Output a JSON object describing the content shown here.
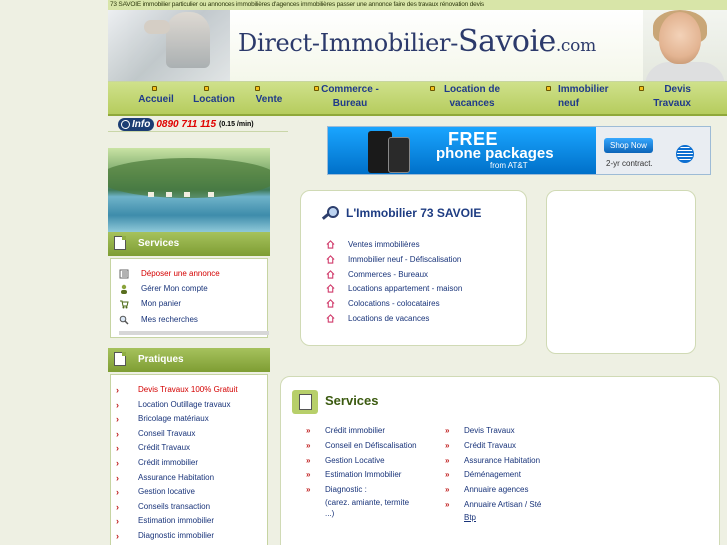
{
  "ticker": "73 SAVOIE immobilier particulier ou annonces immobilières d'agences immobilières passer une annonce faire des travaux rénovation devis",
  "logo": {
    "part1": "Direct-Immobilier-",
    "part2": "Savoie",
    "part3": ".com"
  },
  "nav": [
    {
      "line1": "Accueil",
      "line2": ""
    },
    {
      "line1": "Location",
      "line2": ""
    },
    {
      "line1": "Vente",
      "line2": ""
    },
    {
      "line1": "Commerce -",
      "line2": "Bureau"
    },
    {
      "line1": "Location de",
      "line2": "vacances"
    },
    {
      "line1": "Immobilier",
      "line2": "neuf"
    },
    {
      "line1": "Devis",
      "line2": "Travaux"
    }
  ],
  "info": {
    "label": "Info",
    "phone": "0890 711 115",
    "rate": "(0.15 /min)"
  },
  "ad": {
    "free": "FREE",
    "packages": "phone packages",
    "from": "from AT&T",
    "shop": "Shop Now",
    "contract": "2-yr contract."
  },
  "services_panel": {
    "title": "Services",
    "items": [
      "Déposer une annonce",
      "Gérer Mon compte",
      "Mon panier",
      "Mes recherches"
    ]
  },
  "pratiques_panel": {
    "title": "Pratiques",
    "items": [
      "Devis Travaux 100% Gratuit",
      "Location Outillage travaux",
      "Bricolage matériaux",
      "Conseil Travaux",
      "Crédit Travaux",
      "Crédit immobilier",
      "Assurance Habitation",
      "Gestion locative",
      "Conseils transaction",
      "Estimation immobilier",
      "Diagnostic immobilier"
    ]
  },
  "immo_box": {
    "title": "L'Immobilier 73 SAVOIE",
    "links": [
      "Ventes immobilières",
      "Immobilier neuf - Défiscalisation",
      "Commerces - Bureaux",
      "Locations appartement - maison",
      "Colocations - colocataires",
      "Locations de vacances"
    ]
  },
  "services_box": {
    "title": "Services",
    "col1": [
      "Crédit immobilier",
      "Conseil en Défiscalisation",
      "Gestion Locative",
      "Estimation Immobilier",
      "Diagnostic :"
    ],
    "col1_note": [
      "(carez. amiante, termite",
      "...)"
    ],
    "col2": [
      "Devis Travaux",
      "Crédit Travaux",
      "Assurance Habitation",
      "Déménagement",
      "Annuaire agences",
      "Annuaire Artisan / Sté"
    ],
    "col2_note": "Btp"
  },
  "colors": {
    "nav_bg": "#c2d672",
    "nav_text": "#1f3a8a",
    "link": "#19347a",
    "red": "#d40000",
    "panel_head": "#8fae44"
  }
}
